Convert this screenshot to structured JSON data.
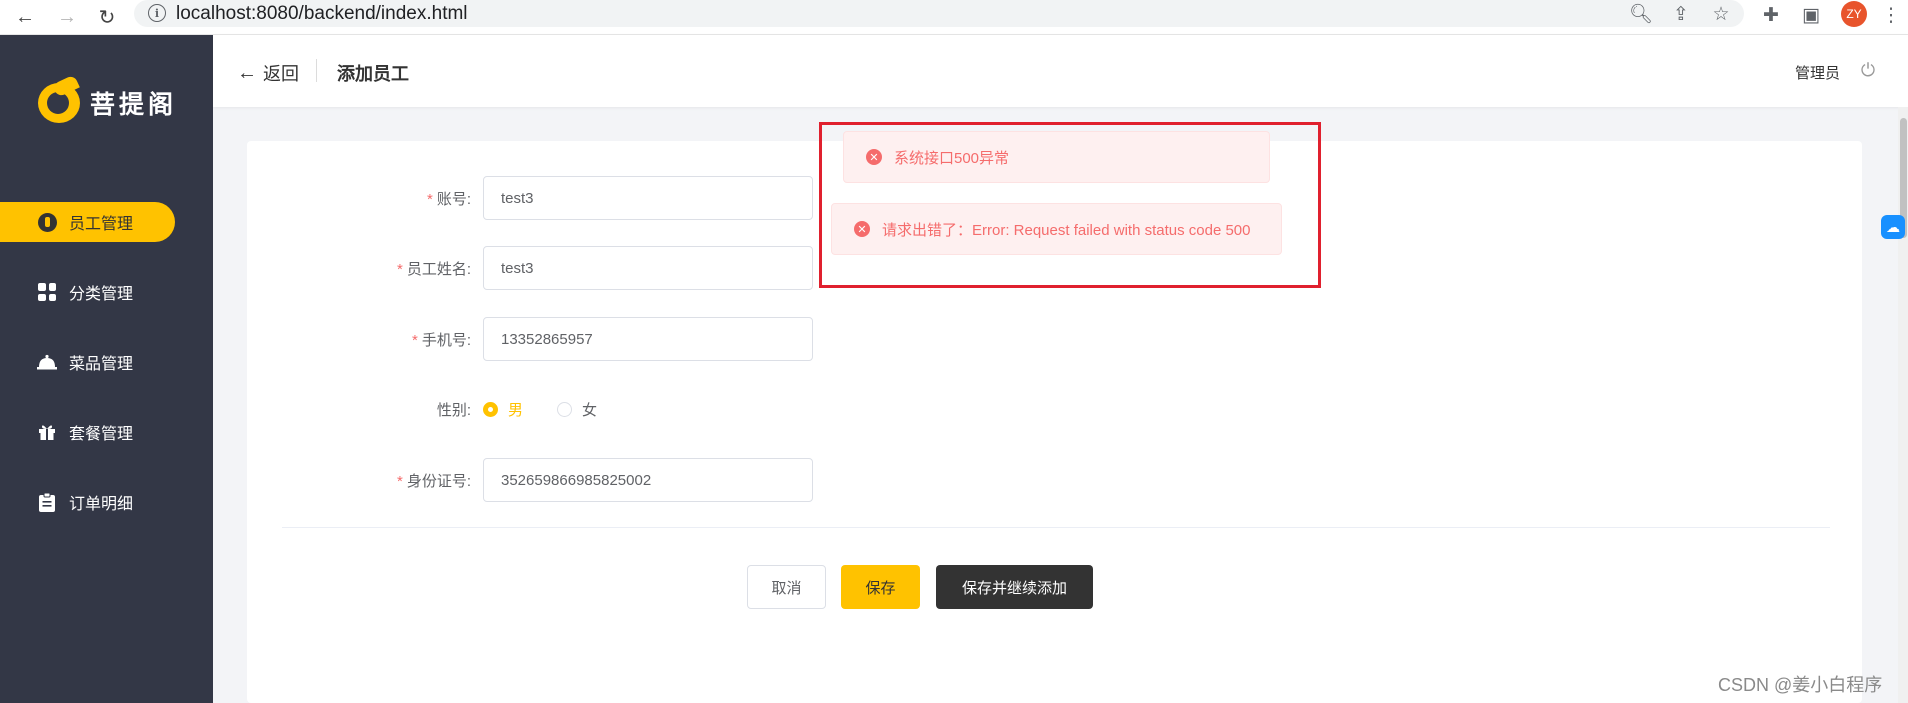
{
  "browser": {
    "back": "←",
    "forward": "→",
    "reload": "↻",
    "url": "localhost:8080/backend/index.html",
    "info": "i",
    "profile_initials": "ZY",
    "icons": [
      "zoom-icon",
      "share-icon",
      "star-icon",
      "extensions-icon",
      "sidepanel-icon",
      "menu-icon"
    ]
  },
  "sidebar": {
    "logo_text": "菩提阁",
    "items": [
      {
        "label": "员工管理",
        "icon": "employee-icon",
        "active": true
      },
      {
        "label": "分类管理",
        "icon": "category-grid-icon",
        "active": false
      },
      {
        "label": "菜品管理",
        "icon": "dish-cloche-icon",
        "active": false
      },
      {
        "label": "套餐管理",
        "icon": "gift-icon",
        "active": false
      },
      {
        "label": "订单明细",
        "icon": "clipboard-icon",
        "active": false
      }
    ]
  },
  "header": {
    "back_label": "返回",
    "title": "添加员工",
    "user_name": "管理员"
  },
  "form": {
    "required_mark": "*",
    "account_label": "账号:",
    "account_value": "test3",
    "name_label": "员工姓名:",
    "name_value": "test3",
    "phone_label": "手机号:",
    "phone_value": "13352865957",
    "gender_label": "性别:",
    "gender_male": "男",
    "gender_female": "女",
    "gender_selected": "男",
    "id_label": "身份证号:",
    "id_value": "352659866985825002"
  },
  "buttons": {
    "cancel": "取消",
    "save": "保存",
    "save_continue": "保存并继续添加"
  },
  "messages": [
    {
      "text": "系统接口500异常"
    },
    {
      "text": "请求出错了：Error: Request failed with status code 500"
    }
  ],
  "colors": {
    "accent": "#ffc200",
    "sidebar": "#333746",
    "error": "#f56c6c",
    "highlight_box": "#e0202e"
  },
  "watermark": "CSDN @姜小白程序"
}
